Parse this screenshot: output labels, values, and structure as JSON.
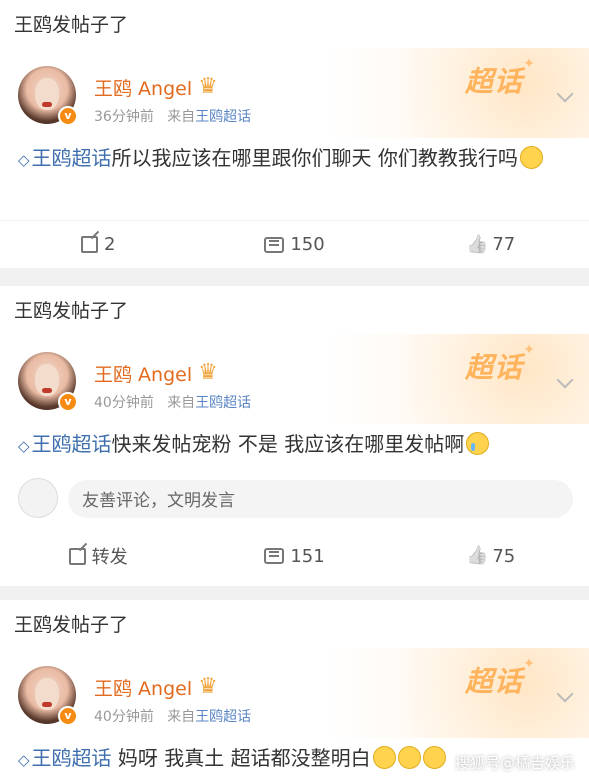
{
  "posts": [
    {
      "header": "王鸥发帖子了",
      "author": "王鸥 Angel",
      "time": "36分钟前",
      "from_prefix": "来自",
      "from_source": "王鸥超话",
      "topic": "王鸥超话",
      "text": "所以我应该在哪里跟你们聊天 你们教教我行吗",
      "badge": "超话",
      "share": "2",
      "comments": "150",
      "likes": "77"
    },
    {
      "header": "王鸥发帖子了",
      "author": "王鸥 Angel",
      "time": "40分钟前",
      "from_prefix": "来自",
      "from_source": "王鸥超话",
      "topic": "王鸥超话",
      "text": "快来发帖宠粉 不是 我应该在哪里发帖啊",
      "badge": "超话",
      "comment_placeholder": "友善评论，文明发言",
      "share": "转发",
      "comments": "151",
      "likes": "75"
    },
    {
      "header": "王鸥发帖子了",
      "author": "王鸥 Angel",
      "time": "40分钟前",
      "from_prefix": "来自",
      "from_source": "王鸥超话",
      "topic": "王鸥超话",
      "text": " 妈呀 我真土 超话都没整明白",
      "badge": "超话"
    }
  ],
  "watermark": "搜狐号@橘吉娱乐",
  "icons": [
    "topic-diamond-icon",
    "crown-icon",
    "verified-v-icon",
    "chevron-down-icon",
    "share-icon",
    "comment-icon",
    "like-icon"
  ],
  "colors": {
    "author": "#e36b1f",
    "topic": "#3f6fae",
    "badge": "#ffb35c",
    "verified": "#f78b12"
  }
}
